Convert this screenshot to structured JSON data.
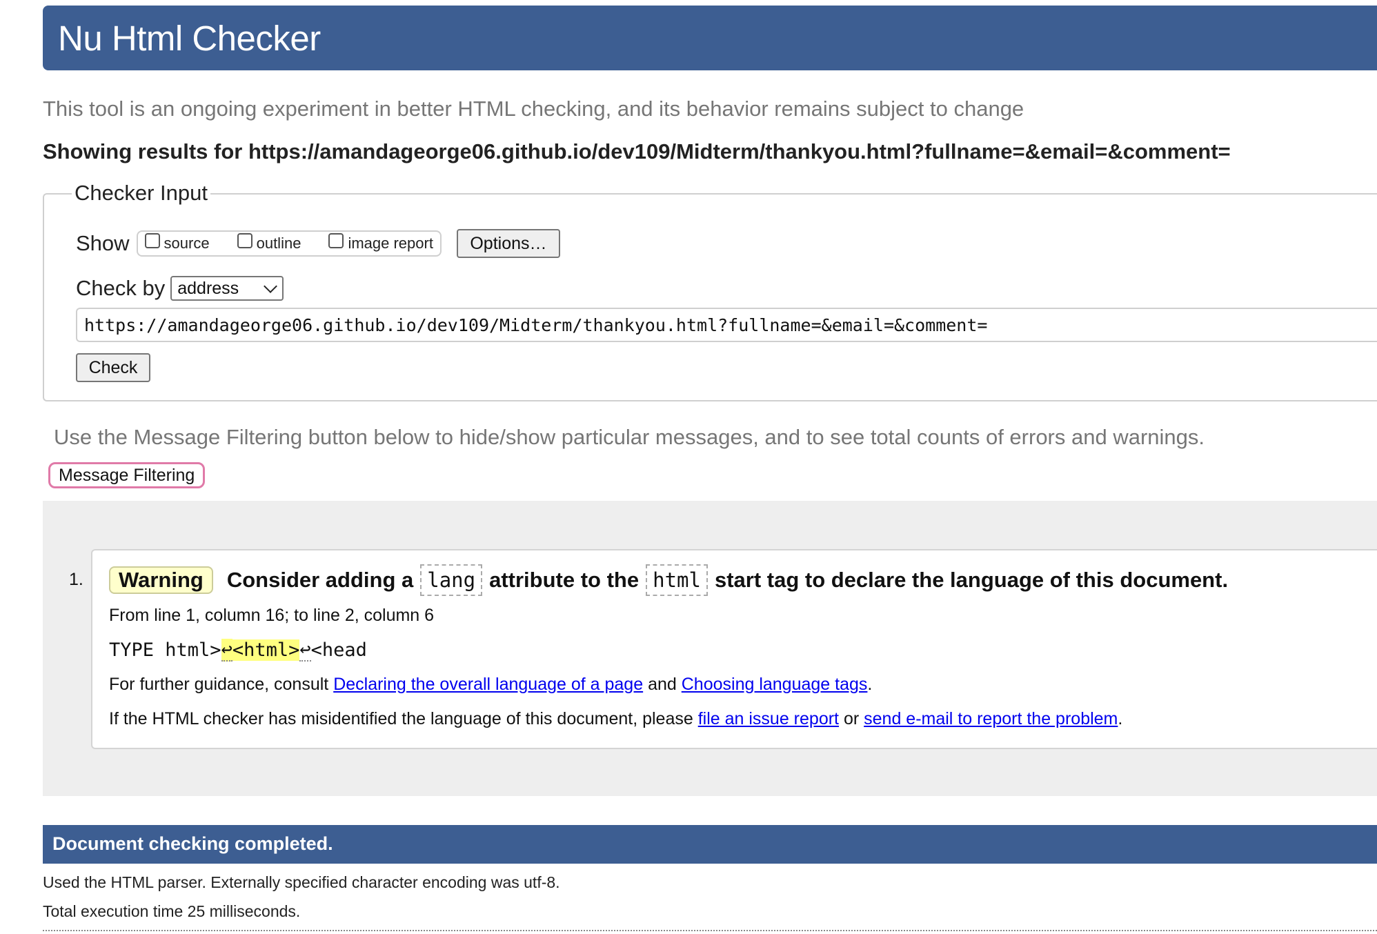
{
  "header": {
    "title": "Nu Html Checker"
  },
  "tagline": "This tool is an ongoing experiment in better HTML checking, and its behavior remains subject to change",
  "showing_results": "Showing results for https://amandageorge06.github.io/dev109/Midterm/thankyou.html?fullname=&email=&comment=",
  "checker_input": {
    "legend": "Checker Input",
    "show_label": "Show",
    "options": [
      {
        "label": "source",
        "checked": false
      },
      {
        "label": "outline",
        "checked": false
      },
      {
        "label": "image report",
        "checked": false
      }
    ],
    "options_button": "Options…",
    "check_by_label": "Check by",
    "check_by_value": "address",
    "url_value": "https://amandageorge06.github.io/dev109/Midterm/thankyou.html?fullname=&email=&comment=",
    "check_button": "Check"
  },
  "filter": {
    "note": "Use the Message Filtering button below to hide/show particular messages, and to see total counts of errors and warnings.",
    "button": "Message Filtering"
  },
  "messages": [
    {
      "number": "1.",
      "type": "Warning",
      "title_part1": "Consider adding a",
      "code1": "lang",
      "title_part2": "attribute to the",
      "code2": "html",
      "title_part3": "start tag to declare the language of this document.",
      "location": "From line 1, column 16; to line 2, column 6",
      "extract_before": "TYPE html>",
      "extract_lf1": "↩",
      "extract_highlight": "<html>",
      "extract_lf2": "↩",
      "extract_after": "<head",
      "guidance_prefix": "For further guidance, consult",
      "guidance_link1": "Declaring the overall language of a page",
      "guidance_and": "and",
      "guidance_link2": "Choosing language tags",
      "guidance_end": ".",
      "report_prefix": "If the HTML checker has misidentified the language of this document, please",
      "report_link1": "file an issue report",
      "report_or": "or",
      "report_link2": "send e-mail to report the problem",
      "report_end": "."
    }
  ],
  "completed": {
    "banner": "Document checking completed.",
    "parser_note": "Used the HTML parser. Externally specified character encoding was utf-8.",
    "time_note": "Total execution time 25 milliseconds."
  },
  "colors": {
    "header_bg": "#3d5e92",
    "warning_badge_bg": "#ffffcc",
    "highlight": "#ffff80",
    "filter_button_border": "#e07aa8",
    "link": "#0000ee"
  }
}
